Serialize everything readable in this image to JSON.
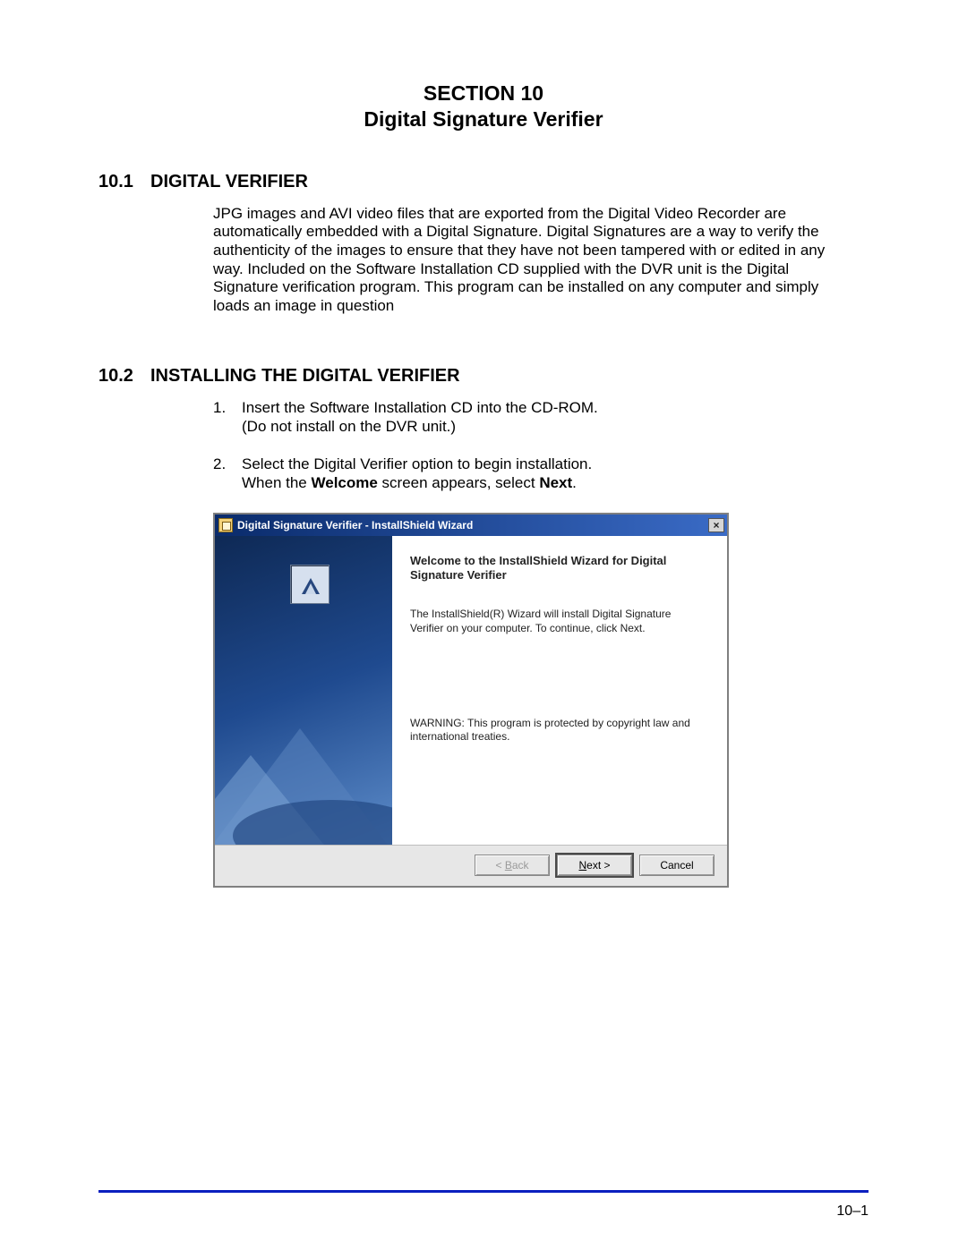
{
  "section": {
    "line1": "SECTION 10",
    "line2": "Digital Signature Verifier"
  },
  "h1": {
    "num": "10.1",
    "title": "DIGITAL VERIFIER"
  },
  "para1": "JPG images and AVI video files that are exported from the Digital Video Recorder are automatically embedded with a Digital Signature. Digital Signatures are a way to verify the authenticity of the images to ensure that they have not been tampered with or edited in any way. Included on the Software Installation CD supplied with the DVR unit is the Digital Signature verification program. This program can be installed on any computer and simply loads an image in question",
  "h2": {
    "num": "10.2",
    "title": "INSTALLING THE DIGITAL VERIFIER"
  },
  "steps": {
    "s1": {
      "num": "1.",
      "l1": "Insert the Software Installation CD into the CD-ROM.",
      "l2": "(Do not install on the DVR unit.)"
    },
    "s2": {
      "num": "2.",
      "l1": "Select the Digital Verifier option to begin installation.",
      "l2a": "When the ",
      "l2b_bold": "Welcome",
      "l2c": " screen appears, select ",
      "l2d_bold": "Next",
      "l2e": "."
    }
  },
  "dialog": {
    "title": "Digital Signature Verifier - InstallShield Wizard",
    "close_label": "×",
    "welcome_heading": "Welcome to the InstallShield Wizard for Digital Signature Verifier",
    "welcome_para": "The InstallShield(R) Wizard will install Digital Signature Verifier on your computer. To continue, click Next.",
    "warning": "WARNING: This program is protected by copyright law and international treaties.",
    "buttons": {
      "back_pre": "< ",
      "back_u": "B",
      "back_post": "ack",
      "next_u": "N",
      "next_post": "ext >",
      "cancel": "Cancel"
    }
  },
  "page_number": "10–1"
}
